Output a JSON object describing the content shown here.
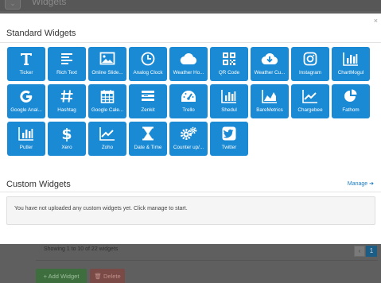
{
  "background": {
    "title": "Widgets",
    "showing_text": "Showing 1 to 10 of 22 widgets",
    "pager_prev": "‹",
    "pager_current": "1",
    "add_label": "+ Add Widget",
    "delete_label": "🗑 Delete"
  },
  "modal": {
    "close_label": "×",
    "standard_title": "Standard Widgets",
    "custom_title": "Custom Widgets",
    "manage_label": "Manage ➔",
    "custom_message": "You have not uploaded any custom widgets yet. Click manage to start."
  },
  "widgets": [
    {
      "label": "Ticker",
      "icon": "ticker-icon"
    },
    {
      "label": "Rich Text",
      "icon": "rich-text-icon"
    },
    {
      "label": "Online Slide...",
      "icon": "image-icon"
    },
    {
      "label": "Analog Clock",
      "icon": "clock-icon"
    },
    {
      "label": "Weather Ho...",
      "icon": "cloud-icon"
    },
    {
      "label": "QR Code",
      "icon": "qr-code-icon"
    },
    {
      "label": "Weather Cu...",
      "icon": "cloud-download-icon"
    },
    {
      "label": "Instagram",
      "icon": "instagram-icon"
    },
    {
      "label": "ChartMogul",
      "icon": "bar-chart-icon"
    },
    {
      "label": "Google Anal...",
      "icon": "google-icon"
    },
    {
      "label": "Hashtag",
      "icon": "hashtag-icon"
    },
    {
      "label": "Google Cale...",
      "icon": "calendar-icon"
    },
    {
      "label": "Zenkit",
      "icon": "zenkit-icon"
    },
    {
      "label": "Trello",
      "icon": "dashboard-icon"
    },
    {
      "label": "Shedul",
      "icon": "bar-chart-icon"
    },
    {
      "label": "BareMetrics",
      "icon": "area-chart-icon"
    },
    {
      "label": "Chargebee",
      "icon": "line-chart-icon"
    },
    {
      "label": "Fathom",
      "icon": "pie-chart-icon"
    },
    {
      "label": "Putler",
      "icon": "bar-chart-icon"
    },
    {
      "label": "Xero",
      "icon": "dollar-icon"
    },
    {
      "label": "Zoho",
      "icon": "line-chart-icon"
    },
    {
      "label": "Date & Time",
      "icon": "hourglass-icon"
    },
    {
      "label": "Counter up/...",
      "icon": "gears-icon"
    },
    {
      "label": "Twitter",
      "icon": "twitter-icon"
    }
  ],
  "colors": {
    "tile": "#1a8ad4",
    "link": "#1a7cc4",
    "overlay": "#5f5f5f"
  }
}
